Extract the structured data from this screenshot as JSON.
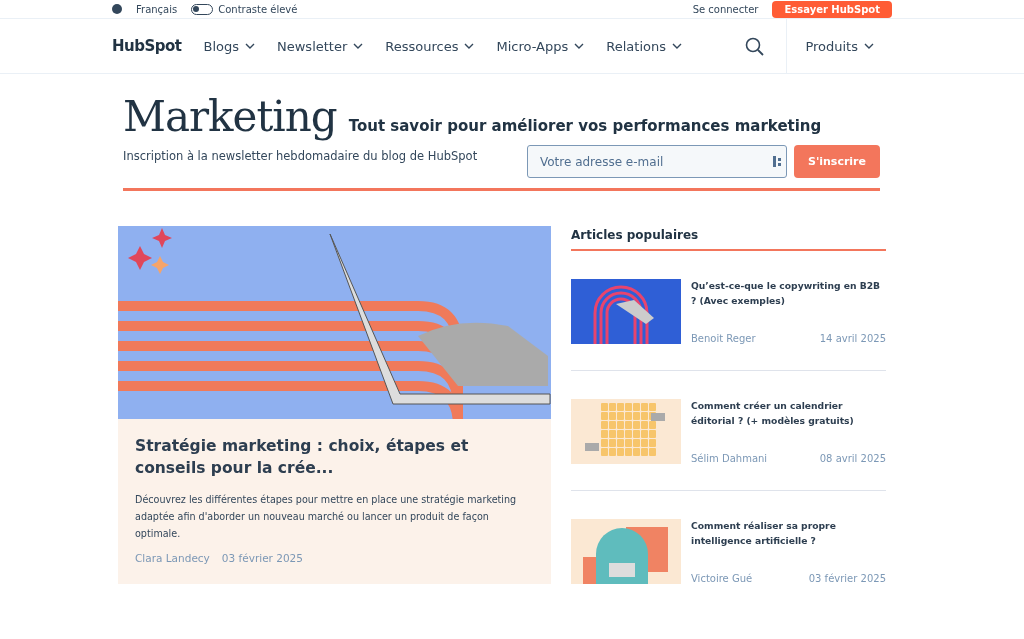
{
  "top_bar": {
    "language": "Français",
    "contrast_toggle": {
      "label": "Contraste élevé",
      "on": false
    },
    "login": "Se connecter",
    "cta": "Essayer HubSpot"
  },
  "nav": {
    "logo": "HubSpot",
    "items": [
      {
        "label": "Blogs"
      },
      {
        "label": "Newsletter"
      },
      {
        "label": "Ressources"
      },
      {
        "label": "Micro-Apps"
      },
      {
        "label": "Relations"
      }
    ],
    "products": "Produits"
  },
  "hero": {
    "title": "Marketing",
    "subtitle": "Tout savoir pour améliorer vos performances marketing",
    "newsletter_text": "Inscription à la newsletter hebdomadaire du blog de HubSpot",
    "email": {
      "placeholder": "Votre adresse e-mail"
    },
    "subscribe": "S'inscrire"
  },
  "featured": {
    "title": "Stratégie marketing : choix, étapes et conseils pour la crée...",
    "excerpt": "Découvrez les différentes étapes pour mettre en place une stratégie marketing adaptée afin d'aborder un nouveau marché ou lancer un produit de façon optimale.",
    "author": "Clara Landecy",
    "date": "03 février 2025"
  },
  "popular": {
    "heading": "Articles populaires",
    "articles": [
      {
        "kind": "arch",
        "title": "Qu’est-ce-que le copywriting en B2B ? (Avec exemples)",
        "author": "Benoit Reger",
        "date": "14 avril 2025"
      },
      {
        "kind": "calendar",
        "title": "Comment créer un calendrier éditorial ? (+ modèles gratuits)",
        "author": "Sélim Dahmani",
        "date": "08 avril 2025"
      },
      {
        "kind": "network",
        "title": "Comment réaliser sa propre intelligence artificielle ?",
        "author": "Victoire Gué",
        "date": "03 février 2025"
      }
    ]
  }
}
